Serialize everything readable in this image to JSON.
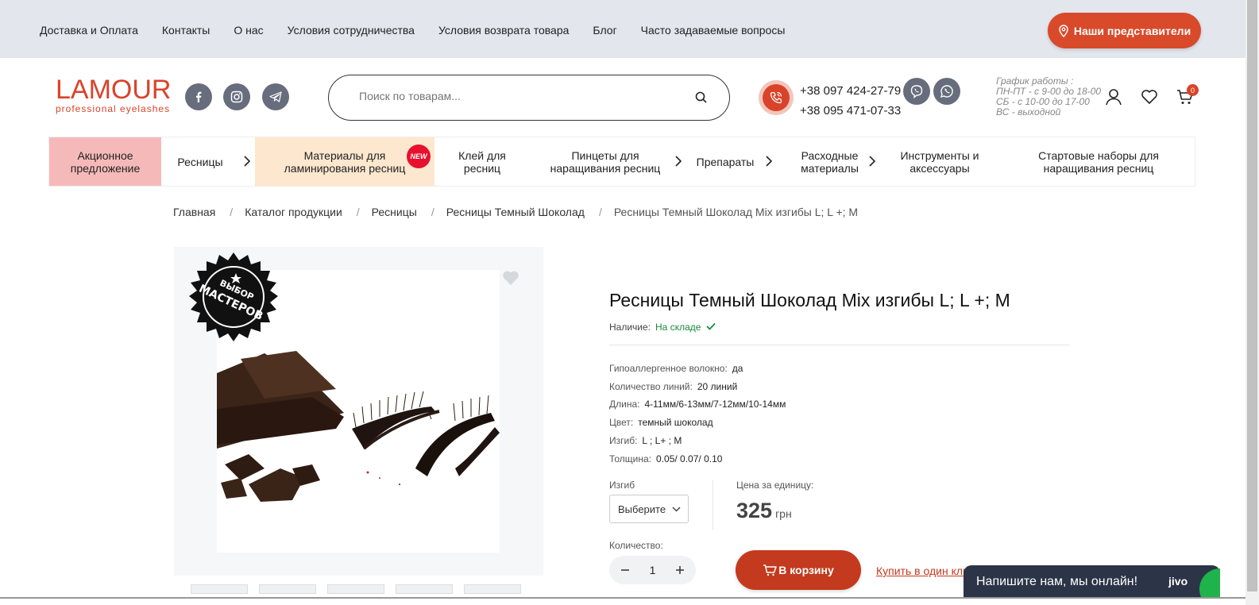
{
  "top_nav": [
    "Доставка и Оплата",
    "Контакты",
    "О нас",
    "Условия сотрудничества",
    "Условия возврата товара",
    "Блог",
    "Часто задаваемые вопросы"
  ],
  "rep_button": "Наши представители",
  "logo": {
    "main": "LAMOUR",
    "sub": "professional eyelashes"
  },
  "search": {
    "placeholder": "Поиск по товарам..."
  },
  "phones": [
    "+38 097 424-27-79",
    "+38 095 471-07-33"
  ],
  "schedule": [
    "График работы :",
    "ПН-ПТ - с 9-00 до 18-00",
    "СБ - с 10-00 до 17-00",
    "ВС - выходной"
  ],
  "cart_count": "0",
  "categories": [
    {
      "label": "Акционное предложение"
    },
    {
      "label": "Ресницы"
    },
    {
      "label": "Материалы для ламинирования ресниц",
      "badge": "NEW"
    },
    {
      "label": "Клей для ресниц"
    },
    {
      "label": "Пинцеты для наращивания ресниц"
    },
    {
      "label": "Препараты"
    },
    {
      "label": "Расходные материалы"
    },
    {
      "label": "Инструменты и аксессуары"
    },
    {
      "label": "Стартовые наборы для наращивания ресниц"
    }
  ],
  "breadcrumbs": [
    "Главная",
    "Каталог продукции",
    "Ресницы",
    "Ресницы Темный Шоколад",
    "Ресницы Темный Шоколад Mix изгибы L; L +; M"
  ],
  "badge_text": [
    "ВЫБОР",
    "МАСТЕРОВ"
  ],
  "product": {
    "title": "Ресницы Темный Шоколад Mix изгибы L; L +; M",
    "availability_label": "Наличие:",
    "availability_value": "На складе",
    "props": [
      {
        "k": "Гипоаллергенное волокно:",
        "v": "да"
      },
      {
        "k": "Количество линий:",
        "v": "20 линий"
      },
      {
        "k": "Длина:",
        "v": "4-11мм/6-13мм/7-12мм/10-14мм"
      },
      {
        "k": "Цвет:",
        "v": "темный шоколад"
      },
      {
        "k": "Изгиб:",
        "v": "L ; L+ ; M"
      },
      {
        "k": "Толщина:",
        "v": "0.05/ 0.07/ 0.10"
      }
    ],
    "bend_label": "Изгиб",
    "bend_select": "Выберите",
    "price_label": "Цена за единицу:",
    "price": "325",
    "currency": "грн",
    "qty_label": "Количество:",
    "qty": "1",
    "cart_button": "В корзину",
    "one_click": "Купить в один клик"
  },
  "chat": {
    "text": "Напишите нам, мы онлайн!",
    "brand": "jivo"
  },
  "colors": {
    "accent": "#d9432a",
    "topbar": "#e3e6ed",
    "promo": "#f6b9b9",
    "lamination": "#fde7cf"
  }
}
